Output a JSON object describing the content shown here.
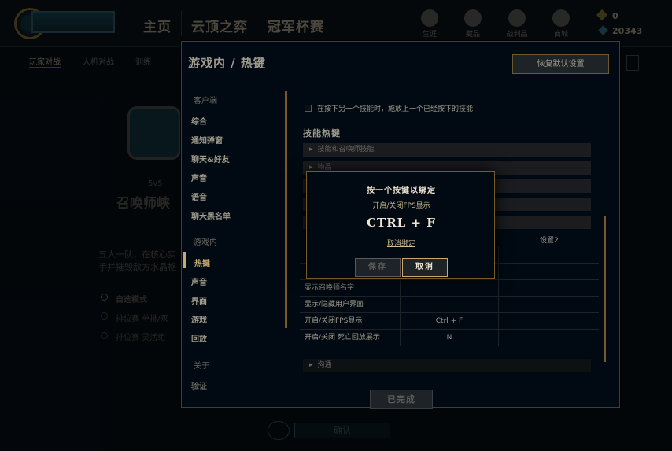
{
  "topbar": {
    "nav": [
      "主页",
      "云顶之弈",
      "冠军杯赛"
    ],
    "icons": [
      {
        "name": "profile-icon",
        "label": "生涯"
      },
      {
        "name": "collection-icon",
        "label": "藏品"
      },
      {
        "name": "battle-pass-icon",
        "label": "战利品"
      },
      {
        "name": "store-icon",
        "label": "商城"
      }
    ],
    "currency": {
      "rp": "0",
      "be": "20343"
    }
  },
  "subnav": [
    "玩家对战",
    "人机对战",
    "训练"
  ],
  "background": {
    "mode": "5v5",
    "map": "召唤师峡",
    "desc_line1": "五人一队，在核心实",
    "desc_line2": "手并摧毁敌方水晶枢",
    "opt1": "自选模式",
    "opt2": "排位赛 单排/双",
    "opt3": "排位赛 灵活组",
    "confirm": "确认"
  },
  "settings": {
    "title": "游戏内 / 热键",
    "restore": "恢复默认设置",
    "client_group": "客户端",
    "client_items": [
      "综合",
      "通知弹窗",
      "聊天&好友",
      "声音",
      "语音",
      "聊天黑名单"
    ],
    "game_group": "游戏内",
    "game_items": [
      "热键",
      "声音",
      "界面",
      "游戏",
      "回放"
    ],
    "about_group": "关于",
    "about_items": [
      "验证"
    ],
    "checkbox_label": "在按下另一个技能时，施放上一个已经按下的技能",
    "section": "技能热键",
    "rows": [
      "技能和召唤师技能",
      "物品",
      "",
      "",
      ""
    ],
    "col_header2": "设置2",
    "hk_rows": [
      {
        "action": "",
        "key1": "",
        "key2": ""
      },
      {
        "action": "",
        "key1": "",
        "key2": ""
      },
      {
        "action": "显示召唤师名字",
        "key1": "",
        "key2": ""
      },
      {
        "action": "显示/隐藏用户界面",
        "key1": "",
        "key2": ""
      },
      {
        "action": "开启/关闭FPS显示",
        "key1": "Ctrl + F",
        "key2": ""
      },
      {
        "action": "开启/关闭 死亡回放展示",
        "key1": "N",
        "key2": ""
      }
    ],
    "chat_row": "沟通",
    "done": "已完成"
  },
  "bind": {
    "title": "按一个按键以绑定",
    "action": "开启/关闭FPS显示",
    "key": "CTRL + F",
    "unbind": "取消绑定",
    "save": "保存",
    "cancel": "取消"
  }
}
